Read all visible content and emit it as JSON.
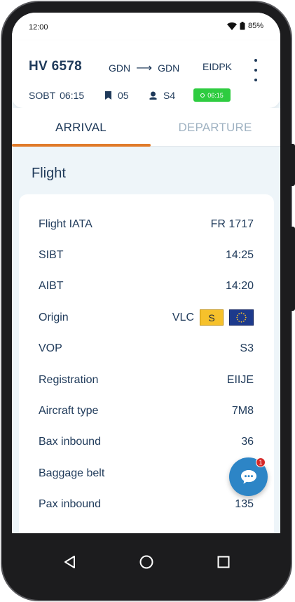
{
  "status_bar": {
    "time": "12:00",
    "battery": "85%"
  },
  "header": {
    "flight_number": "HV 6578",
    "route_from": "GDN",
    "route_to": "GDN",
    "registration": "EIDPK",
    "sobt_label": "SOBT",
    "sobt_time": "06:15",
    "stand": "05",
    "gate": "S4",
    "status_time": "06:15"
  },
  "tabs": [
    {
      "label": "ARRIVAL",
      "active": true
    },
    {
      "label": "DEPARTURE",
      "active": false
    }
  ],
  "section_title": "Flight",
  "flight_details": [
    {
      "label": "Flight IATA",
      "value": "FR 1717"
    },
    {
      "label": "SIBT",
      "value": "14:25"
    },
    {
      "label": "AIBT",
      "value": "14:20"
    },
    {
      "label": "Origin",
      "value": "VLC",
      "badge": "S",
      "flag": "eu-flag"
    },
    {
      "label": "VOP",
      "value": "S3"
    },
    {
      "label": "Registration",
      "value": "EIIJE"
    },
    {
      "label": "Aircraft type",
      "value": "7M8"
    },
    {
      "label": "Bax inbound",
      "value": "36"
    },
    {
      "label": "Baggage belt",
      "value": ""
    },
    {
      "label": "Pax inbound",
      "value": "135"
    }
  ],
  "chat": {
    "unread_count": "1"
  },
  "colors": {
    "accent": "#e07b2a",
    "primary_text": "#1f3a5a",
    "status_green": "#2ecc40",
    "fab_blue": "#2d85c6",
    "badge_red": "#d62828",
    "background": "#eef5f9"
  }
}
